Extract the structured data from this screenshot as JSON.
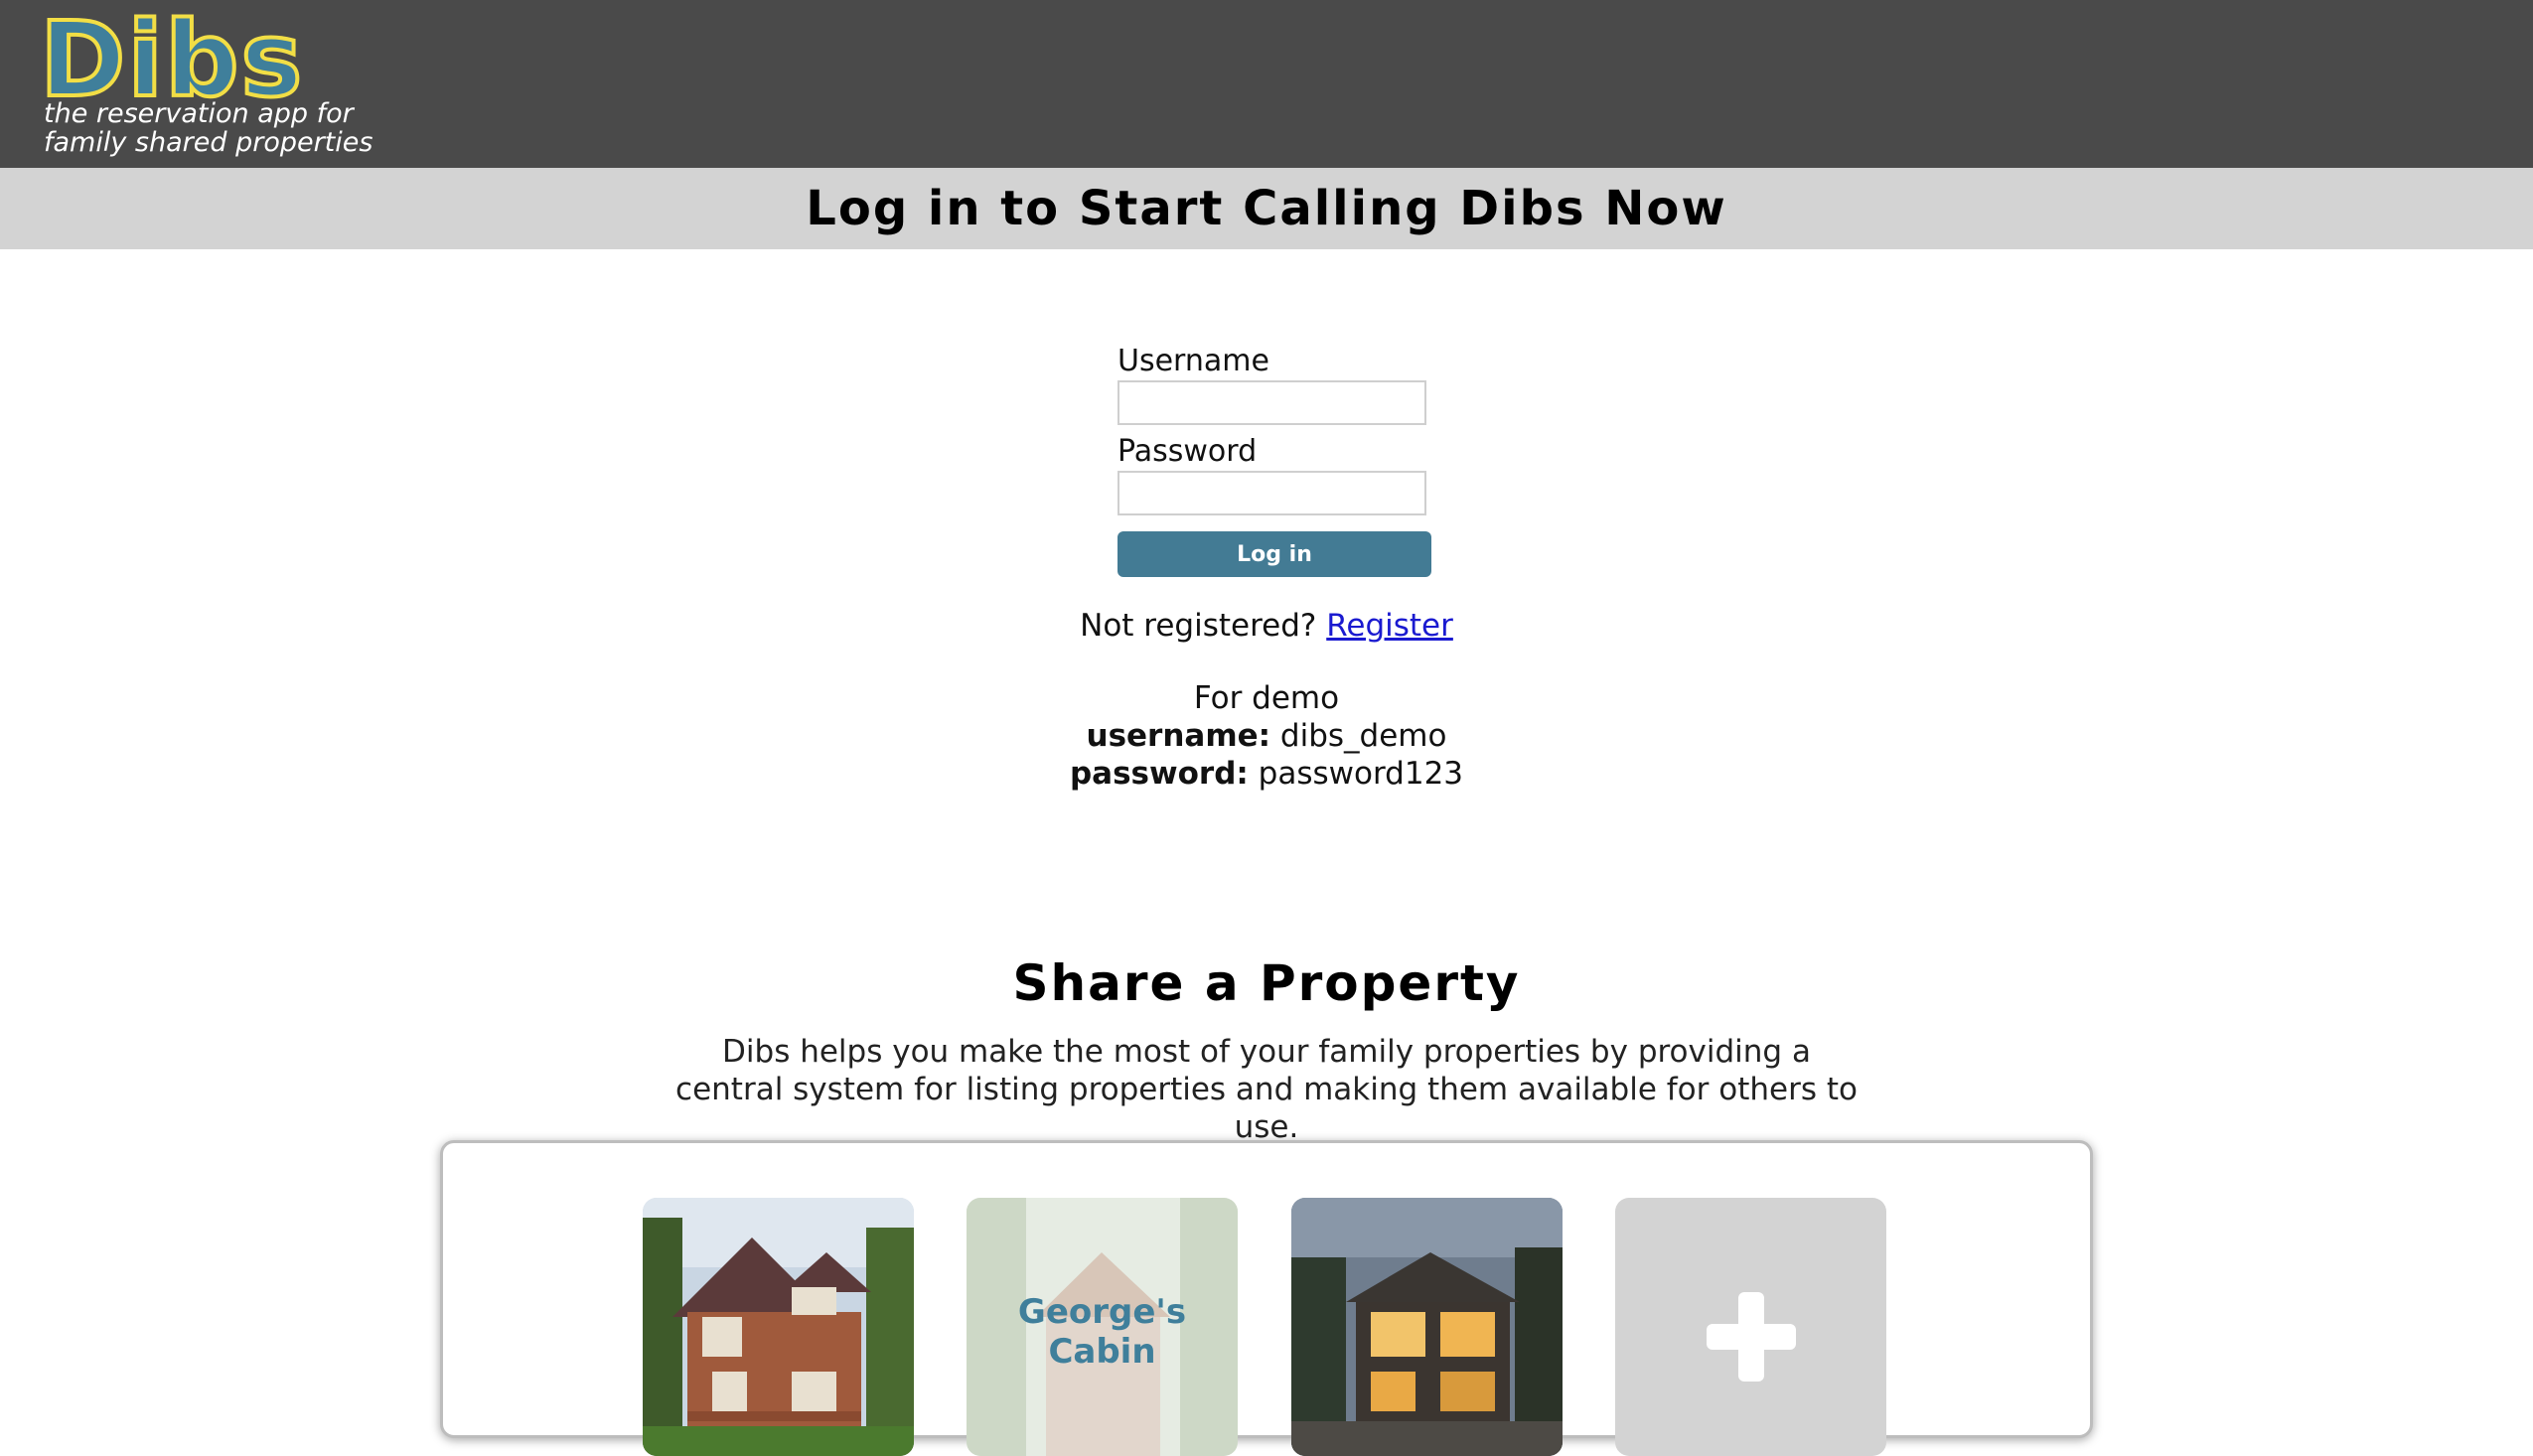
{
  "header": {
    "logo_word": "Dibs",
    "tagline_line1": "the reservation app for",
    "tagline_line2": "family shared properties",
    "background_color": "#4a4a4a",
    "logo_colors": {
      "fill": "#3f7f9b",
      "outline": "#f2de45"
    }
  },
  "banner": {
    "title": "Log in to Start Calling Dibs Now",
    "background_color": "#d3d3d3"
  },
  "login_form": {
    "username_label": "Username",
    "username_value": "",
    "password_label": "Password",
    "password_value": "",
    "submit_label": "Log in",
    "submit_color": "#437b94"
  },
  "register": {
    "prompt": "Not registered?",
    "link_label": "Register"
  },
  "demo": {
    "heading": "For demo",
    "username_key": "username:",
    "username_value": "dibs_demo",
    "password_key": "password:",
    "password_value": "password123"
  },
  "share": {
    "title": "Share a Property",
    "description": "Dibs helps you make the most of your family properties by providing a central system for listing properties and making them available for others to use."
  },
  "property_cards": [
    {
      "kind": "photo",
      "icon": "craftsman-house-photo"
    },
    {
      "kind": "placeholder",
      "label_line1": "George's",
      "label_line2": "Cabin",
      "icon": "cabin-photo"
    },
    {
      "kind": "photo",
      "icon": "modern-house-night-photo"
    },
    {
      "kind": "add",
      "icon": "plus-icon"
    }
  ]
}
